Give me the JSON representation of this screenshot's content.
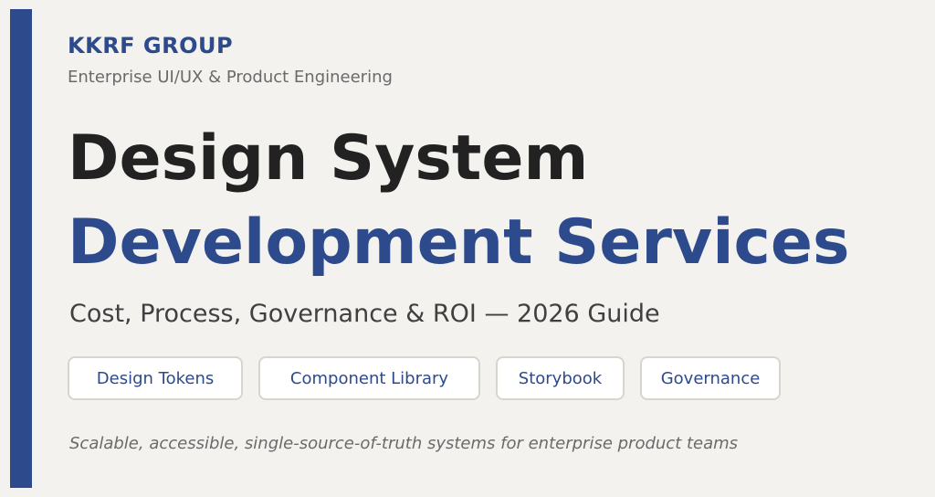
{
  "brand": {
    "name": "KKRF GROUP",
    "tagline": "Enterprise UI/UX & Product Engineering"
  },
  "headline": {
    "line1": "Design System",
    "line2": "Development Services"
  },
  "subtitle": "Cost, Process, Governance & ROI — 2026 Guide",
  "tags": [
    {
      "label": "Design Tokens"
    },
    {
      "label": "Component Library"
    },
    {
      "label": "Storybook"
    },
    {
      "label": "Governance"
    }
  ],
  "footnote": "Scalable, accessible, single-source-of-truth systems for enterprise product teams",
  "colors": {
    "accent": "#2c4a8c",
    "background": "#f4f2ef",
    "heading": "#222222",
    "muted": "#6a6a6a"
  }
}
